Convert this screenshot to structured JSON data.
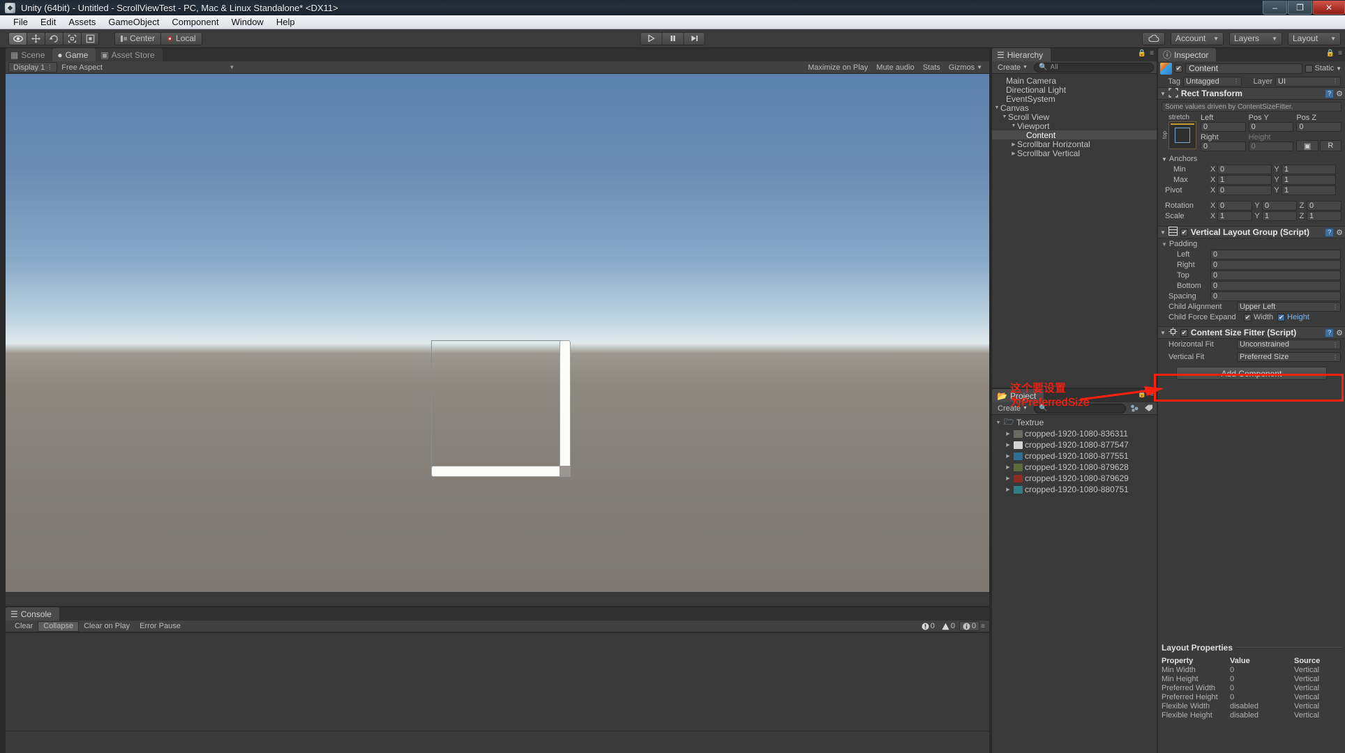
{
  "window": {
    "title": "Unity (64bit) - Untitled - ScrollViewTest - PC, Mac & Linux Standalone* <DX11>",
    "app_icon": "unity-icon",
    "minimize": "–",
    "maximize": "❐",
    "close": "✕"
  },
  "menubar": {
    "items": [
      "File",
      "Edit",
      "Assets",
      "GameObject",
      "Component",
      "Window",
      "Help"
    ]
  },
  "toolbar": {
    "tools": [
      {
        "name": "hand-tool",
        "glyph": "eye",
        "active": true
      },
      {
        "name": "move-tool",
        "glyph": "move",
        "active": false
      },
      {
        "name": "rotate-tool",
        "glyph": "rotate",
        "active": false
      },
      {
        "name": "scale-tool",
        "glyph": "scale",
        "active": false
      },
      {
        "name": "rect-tool",
        "glyph": "rect",
        "active": false
      }
    ],
    "pivot_mode": "Center",
    "pivot_rotation": "Local",
    "play": "▶",
    "pause": "‖",
    "step": "▶|",
    "cloud_label": "cloud-icon",
    "account": "Account",
    "layers": "Layers",
    "layout": "Layout"
  },
  "gameview": {
    "tabs": [
      {
        "label": "Scene",
        "icon": "grid-icon",
        "active": false
      },
      {
        "label": "Game",
        "icon": "gamepad-icon",
        "active": true
      },
      {
        "label": "Asset Store",
        "icon": "store-icon",
        "active": false
      }
    ],
    "display": "Display 1",
    "aspect": "Free Aspect",
    "maximize_on_play": "Maximize on Play",
    "mute_audio": "Mute audio",
    "stats": "Stats",
    "gizmos": "Gizmos"
  },
  "console": {
    "tab": "Console",
    "buttons": [
      {
        "label": "Clear",
        "active": false
      },
      {
        "label": "Collapse",
        "active": true
      },
      {
        "label": "Clear on Play",
        "active": false
      },
      {
        "label": "Error Pause",
        "active": false
      }
    ],
    "counts": {
      "errors": "0",
      "warnings": "0",
      "infos": "0"
    }
  },
  "hierarchy": {
    "tab": "Hierarchy",
    "create": "Create",
    "search_placeholder": "All",
    "items": [
      {
        "label": "Main Camera",
        "depth": 0,
        "twirl": "",
        "selected": false
      },
      {
        "label": "Directional Light",
        "depth": 0,
        "twirl": "",
        "selected": false
      },
      {
        "label": "EventSystem",
        "depth": 0,
        "twirl": "",
        "selected": false
      },
      {
        "label": "Canvas",
        "depth": 0,
        "twirl": "▼",
        "selected": false
      },
      {
        "label": "Scroll View",
        "depth": 1,
        "twirl": "▼",
        "selected": false
      },
      {
        "label": "Viewport",
        "depth": 2,
        "twirl": "▼",
        "selected": false
      },
      {
        "label": "Content",
        "depth": 3,
        "twirl": "",
        "selected": true
      },
      {
        "label": "Scrollbar Horizontal",
        "depth": 2,
        "twirl": "▶",
        "selected": false
      },
      {
        "label": "Scrollbar Vertical",
        "depth": 2,
        "twirl": "▶",
        "selected": false
      }
    ]
  },
  "project": {
    "tab": "Project",
    "create": "Create",
    "search_placeholder": "",
    "root": "Textrue",
    "items": [
      {
        "label": "cropped-1920-1080-836311",
        "color": "#6b6b63"
      },
      {
        "label": "cropped-1920-1080-877547",
        "color": "#d3d3d3"
      },
      {
        "label": "cropped-1920-1080-877551",
        "color": "#2e6f96"
      },
      {
        "label": "cropped-1920-1080-879628",
        "color": "#5d6a3c"
      },
      {
        "label": "cropped-1920-1080-879629",
        "color": "#8e2b22"
      },
      {
        "label": "cropped-1920-1080-880751",
        "color": "#2f7f86"
      }
    ]
  },
  "inspector": {
    "tab": "Inspector",
    "object_name": "Content",
    "object_enabled": "✔",
    "static_label": "Static",
    "tag_label": "Tag",
    "tag_value": "Untagged",
    "layer_label": "Layer",
    "layer_value": "UI",
    "rect_transform": {
      "title": "Rect Transform",
      "driven_note": "Some values driven by ContentSizeFitter.",
      "anchor_preset": "stretch",
      "anchor_side": "top",
      "labels": {
        "left": "Left",
        "posy": "Pos Y",
        "posz": "Pos Z",
        "right": "Right",
        "height": "Height"
      },
      "values": {
        "left": "0",
        "posy": "0",
        "posz": "0",
        "right": "0",
        "height": "0"
      },
      "anchors_label": "Anchors",
      "min_label": "Min",
      "min_x": "0",
      "min_y": "1",
      "max_label": "Max",
      "max_x": "1",
      "max_y": "1",
      "pivot_label": "Pivot",
      "pivot_x": "0",
      "pivot_y": "1",
      "rotation_label": "Rotation",
      "rot_x": "0",
      "rot_y": "0",
      "rot_z": "0",
      "scale_label": "Scale",
      "scale_x": "1",
      "scale_y": "1",
      "scale_z": "1",
      "axis_x": "X",
      "axis_y": "Y",
      "axis_z": "Z"
    },
    "vertical_layout_group": {
      "title": "Vertical Layout Group (Script)",
      "enabled": "✔",
      "padding_label": "Padding",
      "rows": [
        {
          "label": "Left",
          "value": "0"
        },
        {
          "label": "Right",
          "value": "0"
        },
        {
          "label": "Top",
          "value": "0"
        },
        {
          "label": "Bottom",
          "value": "0"
        }
      ],
      "spacing_label": "Spacing",
      "spacing_value": "0",
      "child_alignment_label": "Child Alignment",
      "child_alignment_value": "Upper Left",
      "child_force_expand_label": "Child Force Expand",
      "width_label": "Width",
      "height_label": "Height"
    },
    "content_size_fitter": {
      "title": "Content Size Fitter (Script)",
      "enabled": "✔",
      "horizontal_label": "Horizontal Fit",
      "horizontal_value": "Unconstrained",
      "vertical_label": "Vertical Fit",
      "vertical_value": "Preferred Size"
    },
    "add_component": "Add Component",
    "layout_properties": {
      "title": "Layout Properties",
      "columns": [
        "Property",
        "Value",
        "Source"
      ],
      "rows": [
        [
          "Min Width",
          "0",
          "Vertical"
        ],
        [
          "Min Height",
          "0",
          "Vertical"
        ],
        [
          "Preferred Width",
          "0",
          "Vertical"
        ],
        [
          "Preferred Height",
          "0",
          "Vertical"
        ],
        [
          "Flexible Width",
          "disabled",
          "Vertical"
        ],
        [
          "Flexible Height",
          "disabled",
          "Vertical"
        ]
      ]
    }
  },
  "annotation": {
    "line1": "这个要设置",
    "line2": "为PreferredSize",
    "color": "#ff1f0f"
  }
}
